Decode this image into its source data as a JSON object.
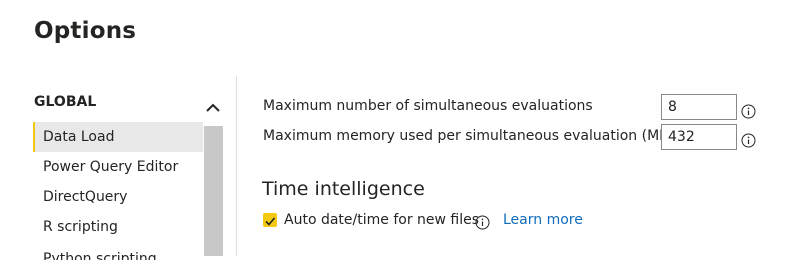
{
  "dialog": {
    "title": "Options"
  },
  "sidebar": {
    "heading": "GLOBAL",
    "items": [
      {
        "label": "Data Load",
        "active": true
      },
      {
        "label": "Power Query Editor",
        "active": false
      },
      {
        "label": "DirectQuery",
        "active": false
      },
      {
        "label": "R scripting",
        "active": false
      },
      {
        "label": "Python scripting",
        "active": false
      }
    ]
  },
  "settings": {
    "max_evaluations_label": "Maximum number of simultaneous evaluations",
    "max_evaluations_value": "8",
    "max_memory_label": "Maximum memory used per simultaneous evaluation (MB)",
    "max_memory_value": "432",
    "time_intelligence": {
      "title": "Time intelligence",
      "auto_datetime_label": "Auto date/time for new files",
      "auto_datetime_checked": true,
      "learn_more": "Learn more"
    }
  },
  "icons": {
    "info": "info-icon",
    "check": "checkmark-icon",
    "scroll_up": "chevron-up-icon"
  },
  "colors": {
    "accent": "#f2c811",
    "link": "#0f6cbd",
    "selected_bg": "#e8e8e8",
    "scroll_thumb": "#c8c8c8"
  }
}
